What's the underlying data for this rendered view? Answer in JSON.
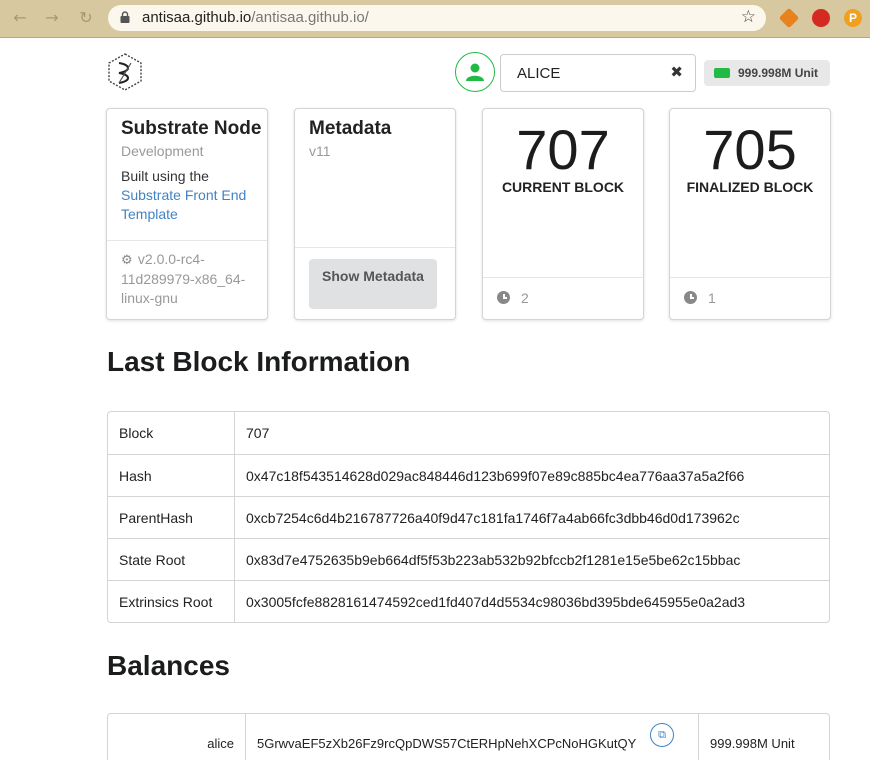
{
  "browser": {
    "url_domain": "antisaa.github.io",
    "url_path": "/antisaa.github.io/",
    "icons": [
      "back-icon",
      "forward-icon",
      "reload-icon",
      "lock-icon",
      "star-icon"
    ]
  },
  "header": {
    "account": "ALICE",
    "balance": "999.998M Unit"
  },
  "cards": {
    "node": {
      "title": "Substrate Node",
      "meta": "Development",
      "desc_prefix": "Built using the",
      "link": "Substrate Front End Template",
      "version": "v2.0.0-rc4-11d289979-x86_64-linux-gnu"
    },
    "metadata": {
      "title": "Metadata",
      "meta": "v11",
      "button": "Show Metadata"
    },
    "current": {
      "value": "707",
      "label": "CURRENT BLOCK",
      "timer": "2"
    },
    "finalized": {
      "value": "705",
      "label": "FINALIZED BLOCK",
      "timer": "1"
    }
  },
  "last_block": {
    "title": "Last Block Information",
    "rows": [
      {
        "key": "Block",
        "value": "707"
      },
      {
        "key": "Hash",
        "value": "0x47c18f543514628d029ac848446d123b699f07e89c885bc4ea776aa37a5a2f66"
      },
      {
        "key": "ParentHash",
        "value": "0xcb7254c6d4b216787726a40f9d47c181fa1746f7a4ab66fc3dbb46d0d173962c"
      },
      {
        "key": "State Root",
        "value": "0x83d7e4752635b9eb664df5f53b223ab532b92bfccb2f1281e15e5be62c15bbac"
      },
      {
        "key": "Extrinsics Root",
        "value": "0x3005fcfe8828161474592ced1fd407d4d5534c98036bd395bde645955e0a2ad3"
      }
    ]
  },
  "balances": {
    "title": "Balances",
    "rows": [
      {
        "name": "alice",
        "address": "5GrwvaEF5zXb26Fz9rcQpDWS57CtERHpNehXCPcNoHGKutQY",
        "balance": "999.998M Unit"
      }
    ]
  }
}
